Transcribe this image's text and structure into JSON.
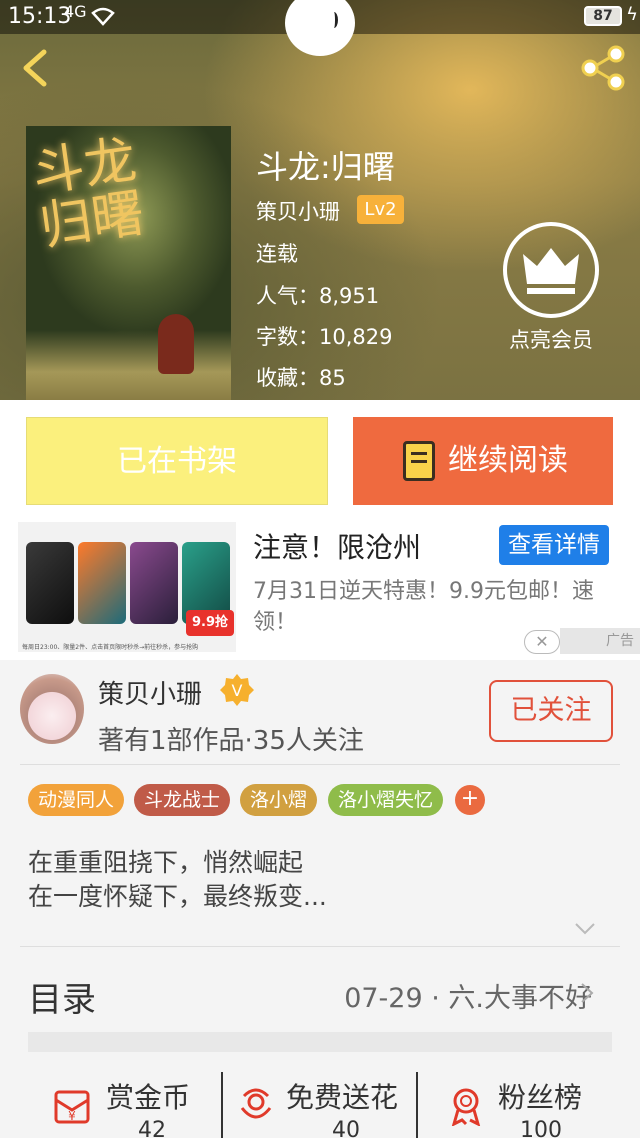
{
  "status_bar": {
    "time": "15:13",
    "signal": "4G",
    "battery": "87"
  },
  "book": {
    "title": "斗龙:归曙",
    "cover_title": "斗龙归曙",
    "author": "策贝小珊",
    "level": "Lv2",
    "status": "连载",
    "stats": [
      {
        "label": "人气",
        "value": "8,951"
      },
      {
        "label": "字数",
        "value": "10,829"
      },
      {
        "label": "收藏",
        "value": "85"
      }
    ]
  },
  "vip": {
    "label": "点亮会员"
  },
  "actions": {
    "shelf_label": "已在书架",
    "read_label": "继续阅读"
  },
  "ad": {
    "headline": "注意！限沧州",
    "detail_button": "查看详情",
    "description": "7月31日逆天特惠！9.9元包邮！速领！",
    "image_badge": "9.9抢",
    "image_fineprint": "每周日23:00、限量2件、点击首页限时秒杀→前往秒杀，参与抢购",
    "close": "✕",
    "label": "广告"
  },
  "author": {
    "name": "策贝小珊",
    "meta": "著有1部作品·35人关注",
    "follow_label": "已关注",
    "verified_badge": "V"
  },
  "tags": [
    {
      "label": "动漫同人",
      "color": "#f2a23a"
    },
    {
      "label": "斗龙战士",
      "color": "#c05b48"
    },
    {
      "label": "洛小熠",
      "color": "#d1a040"
    },
    {
      "label": "洛小熠失忆",
      "color": "#8fbc4a"
    }
  ],
  "tag_add": "+",
  "synopsis": [
    "在重重阻挠下，悄然崛起",
    "在一度怀疑下，最终叛变..."
  ],
  "toc": {
    "label": "目录",
    "latest": "07-29 · 六.大事不好"
  },
  "bottom_actions": [
    {
      "label": "赏金币",
      "count": "42",
      "icon": "coin-envelope-icon"
    },
    {
      "label": "免费送花",
      "count": "40",
      "icon": "flower-icon"
    },
    {
      "label": "粉丝榜",
      "count": "100",
      "icon": "medal-icon"
    }
  ],
  "colors": {
    "accent_orange": "#ef6a3f",
    "shelf_yellow": "#fbf07d",
    "ad_blue": "#1f7fe8",
    "follow_red": "#e1513b"
  }
}
